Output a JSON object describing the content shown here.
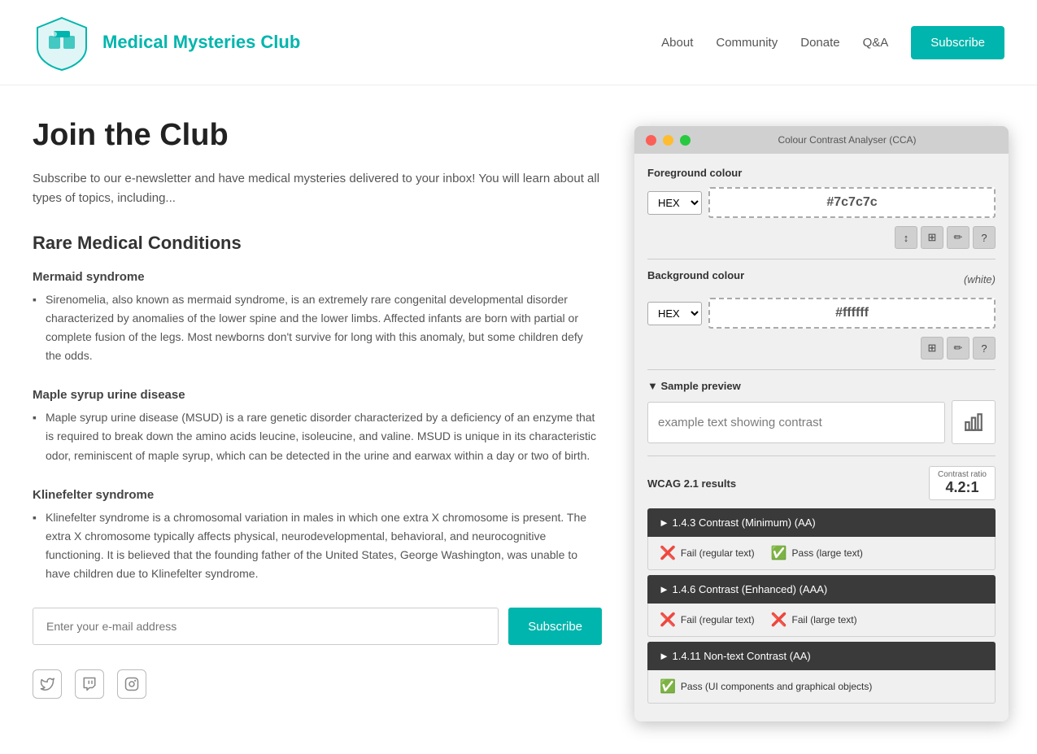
{
  "header": {
    "logo_title": "Medical Mysteries Club",
    "nav": {
      "about": "About",
      "community": "Community",
      "donate": "Donate",
      "qa": "Q&A",
      "subscribe": "Subscribe"
    }
  },
  "main": {
    "heading": "Join the Club",
    "intro": "Subscribe to our e-newsletter and have medical mysteries delivered to your inbox! You will learn about all types of topics, including...",
    "rare_heading": "Rare Medical Conditions",
    "conditions": [
      {
        "name": "Mermaid syndrome",
        "desc": "Sirenomelia, also known as mermaid syndrome, is an extremely rare congenital developmental disorder characterized by anomalies of the lower spine and the lower limbs. Affected infants are born with partial or complete fusion of the legs. Most newborns don't survive for long with this anomaly, but some children defy the odds."
      },
      {
        "name": "Maple syrup urine disease",
        "desc": "Maple syrup urine disease (MSUD) is a rare genetic disorder characterized by a deficiency of an enzyme that is required to break down the amino acids leucine, isoleucine, and valine. MSUD is unique in its characteristic odor, reminiscent of maple syrup, which can be detected in the urine and earwax within a day or two of birth."
      },
      {
        "name": "Klinefelter syndrome",
        "desc": "Klinefelter syndrome is a chromosomal variation in males in which one extra X chromosome is present. The extra X chromosome typically affects physical, neurodevelopmental, behavioral, and neurocognitive functioning. It is believed that the founding father of the United States, George Washington, was unable to have children due to Klinefelter syndrome."
      }
    ],
    "email_placeholder": "Enter your e-mail address",
    "subscribe_btn": "Subscribe"
  },
  "cca": {
    "title": "Colour Contrast Analyser (CCA)",
    "foreground_label": "Foreground colour",
    "fg_format": "HEX",
    "fg_value": "#7c7c7c",
    "bg_label": "Background colour",
    "bg_white_label": "(white)",
    "bg_format": "HEX",
    "bg_value": "#ffffff",
    "sample_preview_label": "▼ Sample preview",
    "sample_text": "example text showing contrast",
    "wcag_label": "WCAG 2.1 results",
    "contrast_ratio_label": "Contrast ratio",
    "contrast_ratio_value": "4.2:1",
    "accordions": [
      {
        "header": "► 1.4.3 Contrast (Minimum) (AA)",
        "results": [
          {
            "icon": "fail",
            "text": "Fail (regular text)"
          },
          {
            "icon": "pass",
            "text": "Pass (large text)"
          }
        ]
      },
      {
        "header": "► 1.4.6 Contrast (Enhanced) (AAA)",
        "results": [
          {
            "icon": "fail",
            "text": "Fail (regular text)"
          },
          {
            "icon": "fail",
            "text": "Fail (large text)"
          }
        ]
      },
      {
        "header": "► 1.4.11 Non-text Contrast (AA)",
        "results": [
          {
            "icon": "pass",
            "text": "Pass (UI components and graphical objects)"
          }
        ]
      }
    ]
  }
}
